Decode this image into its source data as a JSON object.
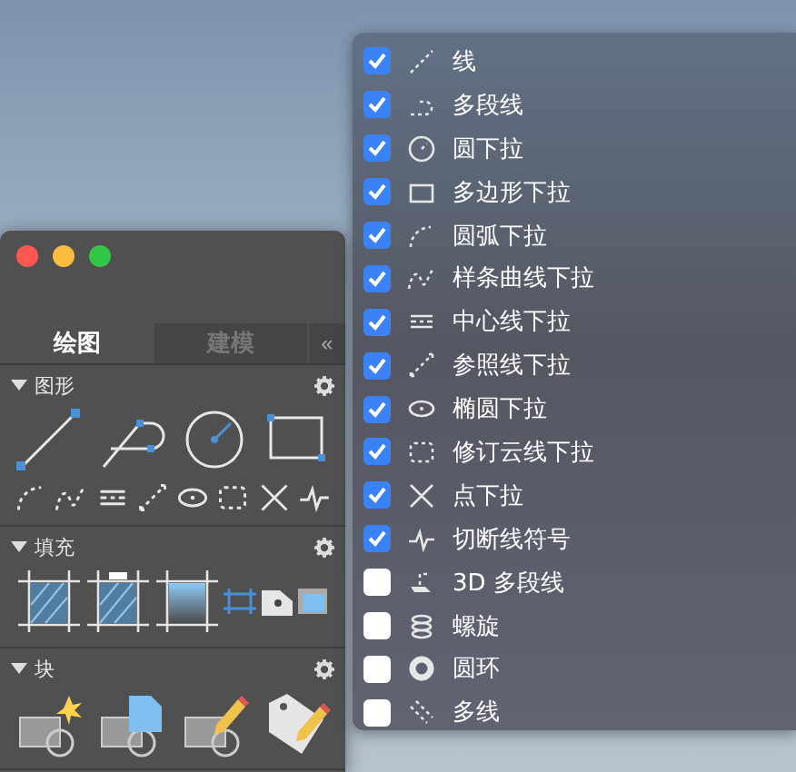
{
  "palette": {
    "tabs": [
      {
        "label": "绘图",
        "selected": true
      },
      {
        "label": "建模",
        "selected": false
      }
    ],
    "collapse_button": "«",
    "sections": [
      {
        "title": "图形"
      },
      {
        "title": "填充"
      },
      {
        "title": "块"
      }
    ]
  },
  "menu": {
    "items": [
      {
        "label": "线",
        "checked": true
      },
      {
        "label": "多段线",
        "checked": true
      },
      {
        "label": "圆下拉",
        "checked": true
      },
      {
        "label": "多边形下拉",
        "checked": true
      },
      {
        "label": "圆弧下拉",
        "checked": true
      },
      {
        "label": "样条曲线下拉",
        "checked": true
      },
      {
        "label": "中心线下拉",
        "checked": true
      },
      {
        "label": "参照线下拉",
        "checked": true
      },
      {
        "label": "椭圆下拉",
        "checked": true
      },
      {
        "label": "修订云线下拉",
        "checked": true
      },
      {
        "label": "点下拉",
        "checked": true
      },
      {
        "label": "切断线符号",
        "checked": true
      },
      {
        "label": "3D 多段线",
        "checked": false
      },
      {
        "label": "螺旋",
        "checked": false
      },
      {
        "label": "圆环",
        "checked": false
      },
      {
        "label": "多线",
        "checked": false
      }
    ]
  }
}
